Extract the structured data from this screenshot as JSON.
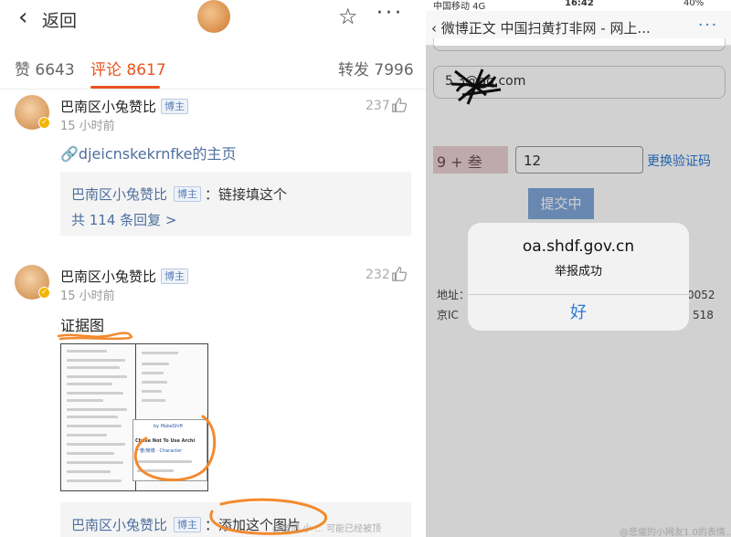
{
  "left": {
    "back_label": "返回",
    "tabs": {
      "likes": "赞 6643",
      "comments": "评论 8617",
      "reposts": "转发 7996"
    },
    "comments": [
      {
        "username": "巴南区小兔赞比",
        "tag": "博主",
        "time": "15 小时前",
        "likes": "237",
        "link_text": "🔗djeicnskekrnfke的主页",
        "reply": {
          "name": "巴南区小兔赞比",
          "tag": "博主",
          "text": "：链接填这个",
          "more": "共 114 条回复 >"
        }
      },
      {
        "username": "巴南区小兔赞比",
        "tag": "博主",
        "time": "15 小时前",
        "likes": "232",
        "text": "证据图",
        "image_snippets": {
          "popup_title": "Chose Not To Use Archi",
          "popup_line": "一瞥/微博 · Character",
          "brand": "by MakeShift"
        },
        "reply": {
          "name": "巴南区小兔赞比",
          "tag": "博主",
          "text": "：添加这个图片"
        }
      }
    ]
  },
  "right": {
    "status": {
      "carrier": "中国移动  4G",
      "time": "16:42",
      "battery": "40%"
    },
    "nav_title": "‹ 微博正文 中国扫黄打非网 - 网上...",
    "more": "···",
    "email_value": "5          3@qq.com",
    "captcha_text": "9  +  叁",
    "captcha_value": "12",
    "refresh_label": "更换验证码",
    "submit_label": "提交中",
    "footer_addr_label": "地址：",
    "footer_addr_tail": "0052",
    "footer_icp_label": "京IC",
    "footer_icp_tail": "518",
    "alert": {
      "title": "oa.shdf.gov.cn",
      "message": "举报成功",
      "button": "好"
    }
  },
  "watermarks": {
    "left": "@微博 小 ... 可能已经被顶",
    "right": "@悲催的小网友1.0的表情..."
  }
}
